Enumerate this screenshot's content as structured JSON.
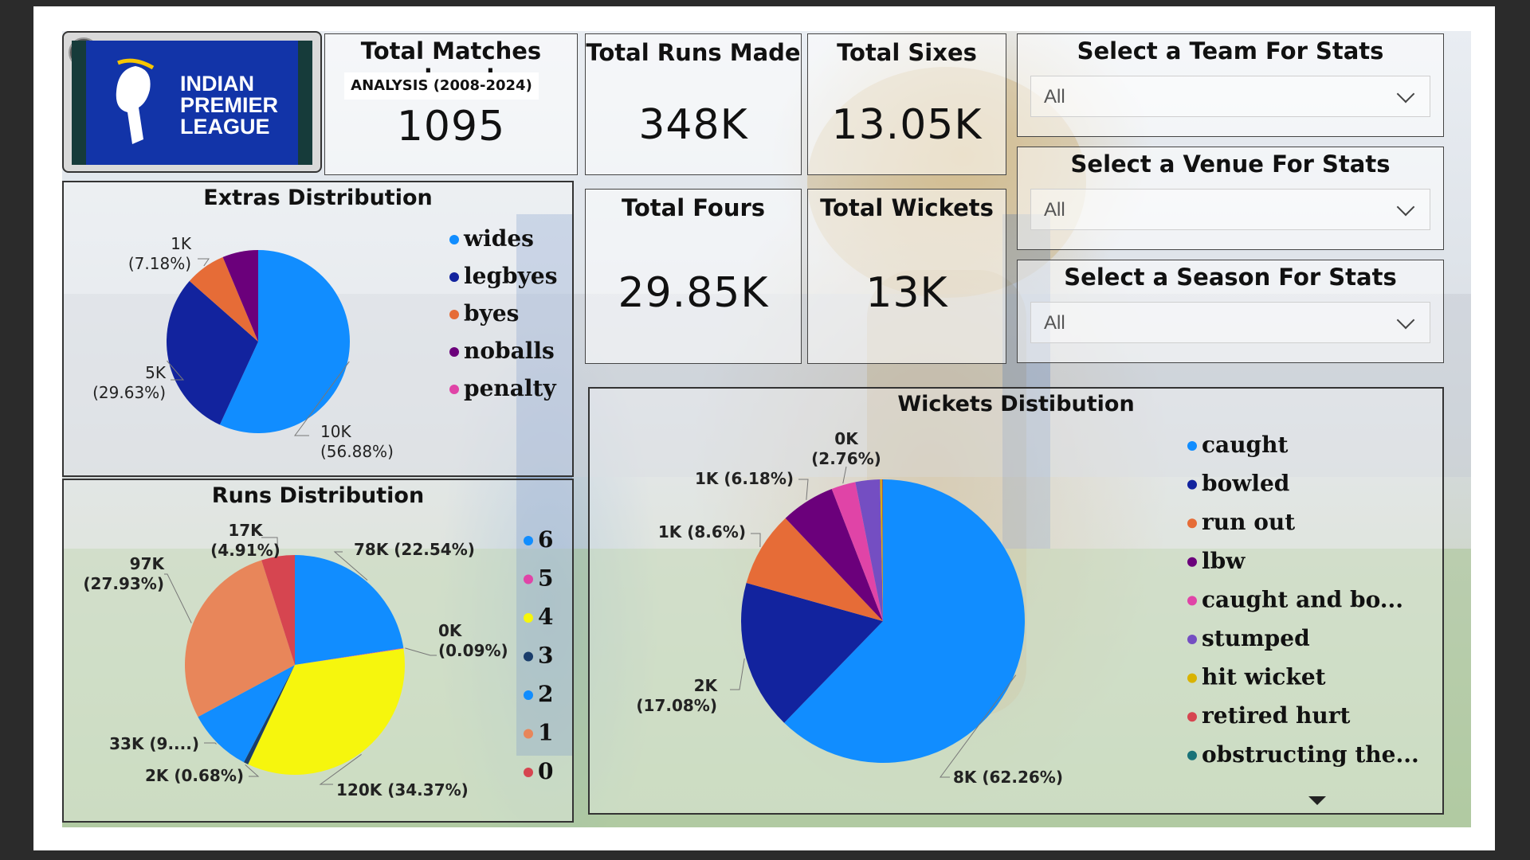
{
  "header": {
    "logo_text": [
      "INDIAN",
      "PREMIER",
      "LEAGUE"
    ],
    "back_icon": "back-arrow-icon"
  },
  "kpis": {
    "matches": {
      "title": "Total Matches played",
      "subtitle": "ANALYSIS (2008-2024)",
      "value": "1095"
    },
    "runs": {
      "title": "Total Runs Made",
      "value": "348K"
    },
    "sixes": {
      "title": "Total Sixes",
      "value": "13.05K"
    },
    "fours": {
      "title": "Total Fours",
      "value": "29.85K"
    },
    "wickets": {
      "title": "Total Wickets",
      "value": "13K"
    }
  },
  "slicers": {
    "team": {
      "title": "Select a Team For Stats",
      "value": "All"
    },
    "venue": {
      "title": "Select a Venue For Stats",
      "value": "All"
    },
    "season": {
      "title": "Select a Season For Stats",
      "value": "All"
    }
  },
  "chart_data": [
    {
      "type": "pie",
      "title": "Extras Distribution",
      "categories": [
        "wides",
        "legbyes",
        "byes",
        "noballs",
        "penalty"
      ],
      "values": [
        56.88,
        29.63,
        7.18,
        6.31,
        0.0
      ],
      "colors": [
        "#118dff",
        "#12239e",
        "#e66c37",
        "#6b007b",
        "#e044a7"
      ],
      "data_labels": [
        {
          "category": "wides",
          "lines": [
            "10K",
            "(56.88%)"
          ]
        },
        {
          "category": "legbyes",
          "lines": [
            "5K",
            "(29.63%)"
          ]
        },
        {
          "category": "byes",
          "lines": [
            "1K",
            "(7.18%)"
          ]
        }
      ],
      "legend": "right"
    },
    {
      "type": "pie",
      "title": "Runs Distribution",
      "categories": [
        "6",
        "5",
        "4",
        "3",
        "2",
        "1",
        "0"
      ],
      "values": [
        22.54,
        0.09,
        34.37,
        0.68,
        9.48,
        27.93,
        4.91
      ],
      "colors": [
        "#118dff",
        "#e044a7",
        "#f6f60d",
        "#1a3d6b",
        "#118dff",
        "#e8865a",
        "#d64550"
      ],
      "data_labels": [
        {
          "category": "6",
          "lines": [
            "78K (22.54%)"
          ]
        },
        {
          "category": "5",
          "lines": [
            "0K",
            "(0.09%)"
          ]
        },
        {
          "category": "4",
          "lines": [
            "120K (34.37%)"
          ]
        },
        {
          "category": "3",
          "lines": [
            "2K (0.68%)"
          ]
        },
        {
          "category": "2",
          "lines": [
            "33K (9....)"
          ]
        },
        {
          "category": "1",
          "lines": [
            "97K",
            "(27.93%)"
          ]
        },
        {
          "category": "0",
          "lines": [
            "17K",
            "(4.91%)"
          ]
        }
      ],
      "legend": "right"
    },
    {
      "type": "pie",
      "title": "Wickets Distibution",
      "categories": [
        "caught",
        "bowled",
        "run out",
        "lbw",
        "caught and bo...",
        "stumped",
        "hit wicket",
        "retired hurt",
        "obstructing the..."
      ],
      "values": [
        62.26,
        17.08,
        8.6,
        6.18,
        2.76,
        2.8,
        0.2,
        0.08,
        0.04
      ],
      "colors": [
        "#118dff",
        "#12239e",
        "#e66c37",
        "#6b007b",
        "#e044a7",
        "#744ec2",
        "#d9b300",
        "#d64550",
        "#197278"
      ],
      "data_labels": [
        {
          "category": "caught",
          "lines": [
            "8K (62.26%)"
          ]
        },
        {
          "category": "bowled",
          "lines": [
            "2K",
            "(17.08%)"
          ]
        },
        {
          "category": "run out",
          "lines": [
            "1K (8.6%)"
          ]
        },
        {
          "category": "lbw",
          "lines": [
            "1K (6.18%)"
          ]
        },
        {
          "category": "caught and bo...",
          "lines": [
            "0K",
            "(2.76%)"
          ]
        }
      ],
      "legend": "right"
    }
  ]
}
